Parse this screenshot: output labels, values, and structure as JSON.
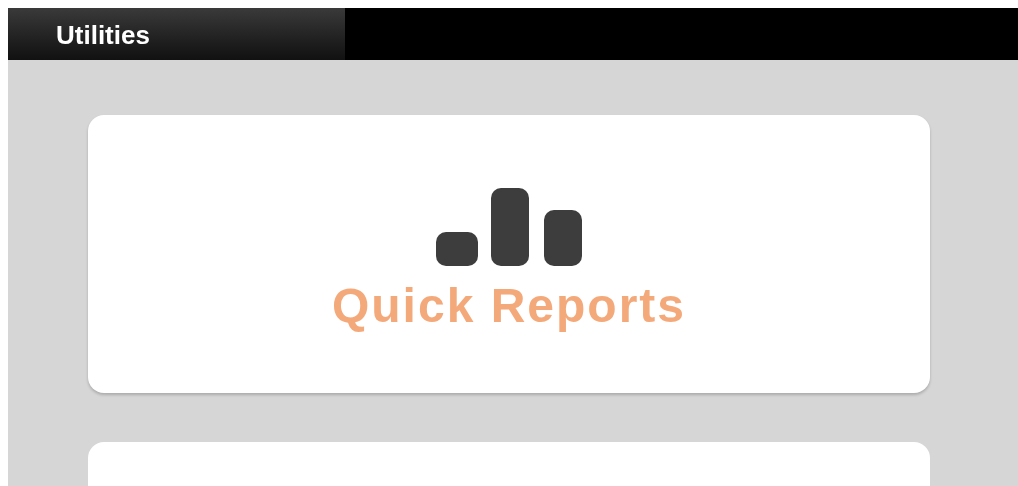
{
  "header": {
    "tab": "Utilities"
  },
  "tiles": [
    {
      "label": "Quick Reports"
    }
  ]
}
